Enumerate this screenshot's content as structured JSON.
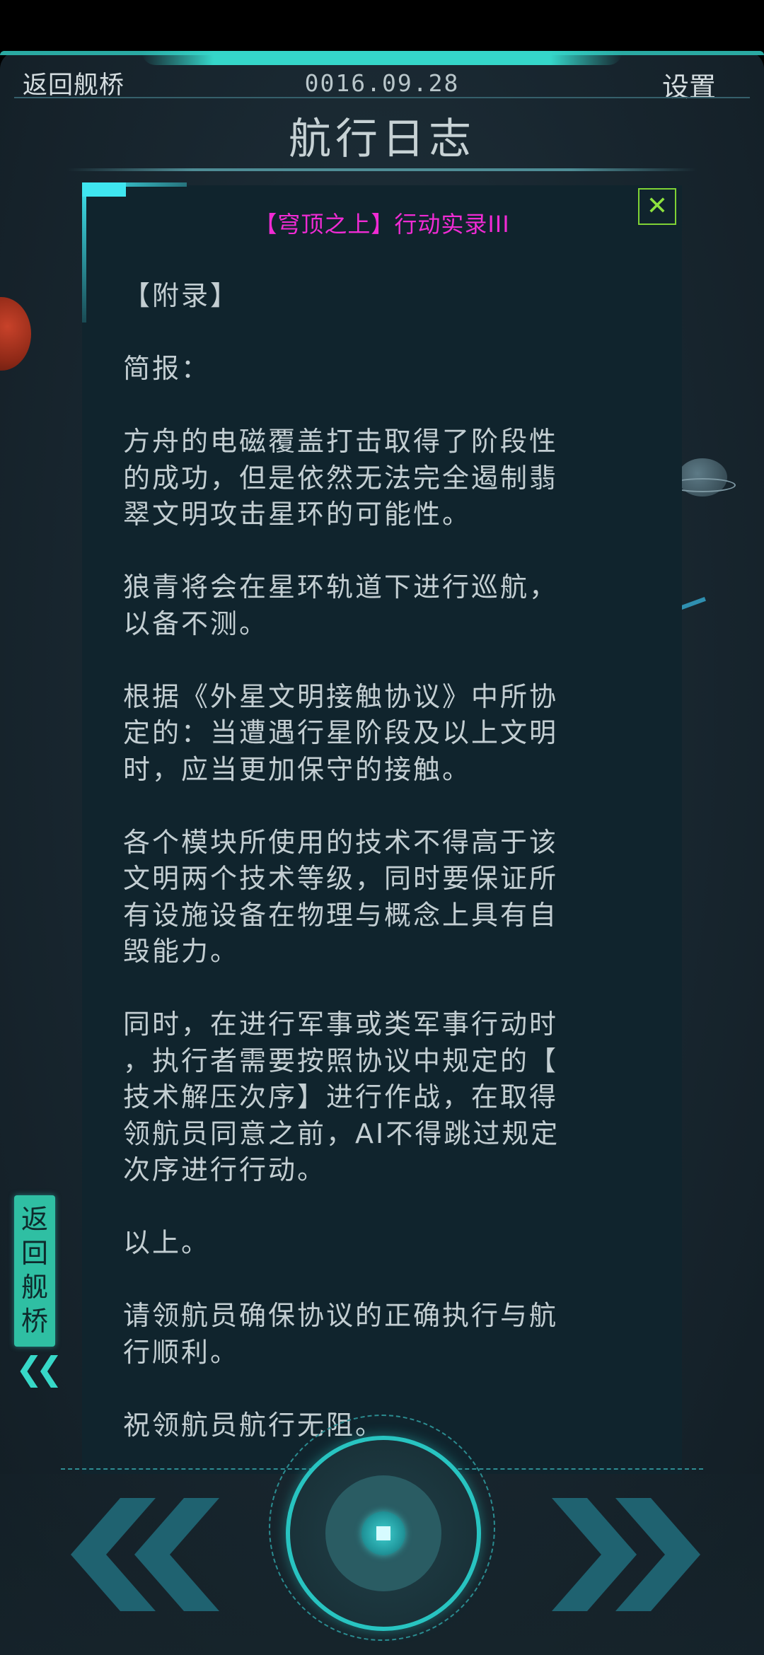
{
  "header": {
    "back_label": "返回舰桥",
    "date": "0016.09.28",
    "settings_label": "设置",
    "title": "航行日志"
  },
  "log": {
    "title": "【穹顶之上】行动实录III",
    "close_icon": "close-icon",
    "paragraphs": [
      "【附录】",
      "简报：",
      "方舟的电磁覆盖打击取得了阶段性\n的成功，但是依然无法完全遏制翡\n翠文明攻击星环的可能性。",
      "狼青将会在星环轨道下进行巡航，\n以备不测。",
      "根据《外星文明接触协议》中所协\n定的：当遭遇行星阶段及以上文明\n时，应当更加保守的接触。",
      "各个模块所使用的技术不得高于该\n文明两个技术等级，同时要保证所\n有设施设备在物理与概念上具有自\n毁能力。",
      "同时，在进行军事或类军事行动时\n，执行者需要按照协议中规定的【\n技术解压次序】进行作战，在取得\n领航员同意之前，AI不得跳过规定\n次序进行行动。",
      "以上。",
      "请领航员确保协议的正确执行与航\n行顺利。",
      "祝领航员航行无阻。"
    ]
  },
  "side_tab": {
    "label": "返\n回\n舰\n桥",
    "arrow_icon": "double-chevron-left-icon"
  },
  "controls": {
    "prev_icon": "double-chevron-left-icon",
    "next_icon": "double-chevron-right-icon",
    "center_icon": "core-button-icon"
  },
  "colors": {
    "accent_cyan": "#35d6c9",
    "title_magenta": "#f02bd4",
    "close_green": "#8ee33e",
    "panel_bg": "#10242d",
    "text": "#c3ced2"
  }
}
